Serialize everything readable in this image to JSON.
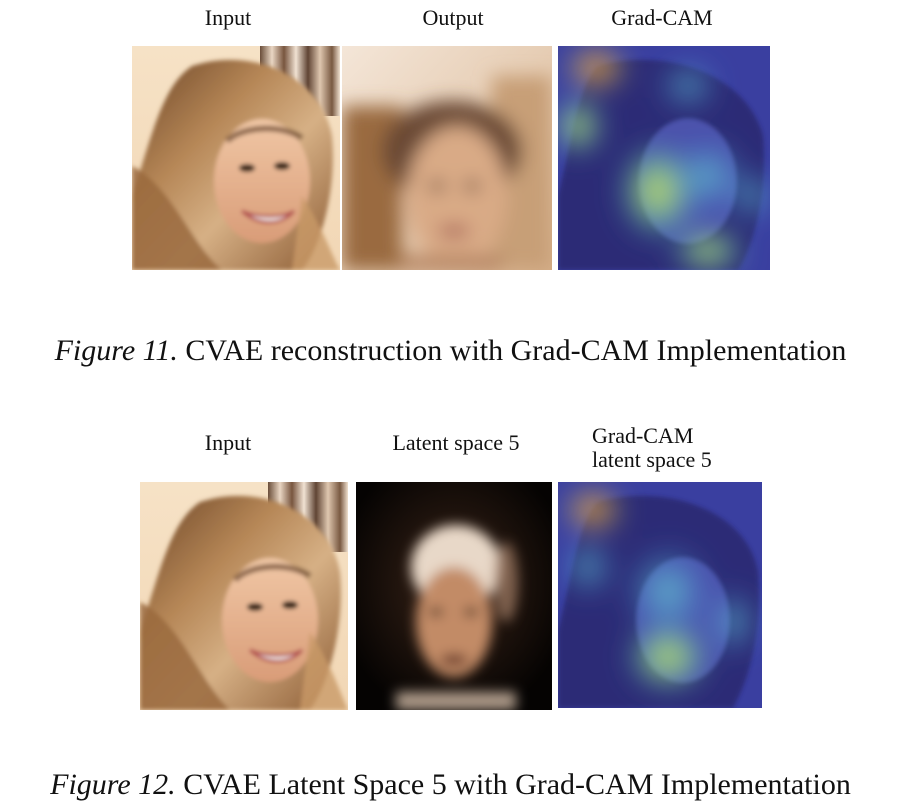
{
  "figure11": {
    "labels": [
      "Input",
      "Output",
      "Grad-CAM"
    ],
    "caption_label": "Figure 11.",
    "caption_text": " CVAE reconstruction with Grad-CAM Implementation"
  },
  "figure12": {
    "labels": [
      "Input",
      "Latent space 5"
    ],
    "gradcam_label_line1": "Grad-CAM",
    "gradcam_label_line2": "latent space 5",
    "caption_label": "Figure 12.",
    "caption_text": " CVAE Latent Space 5 with Grad-CAM Implementation"
  }
}
